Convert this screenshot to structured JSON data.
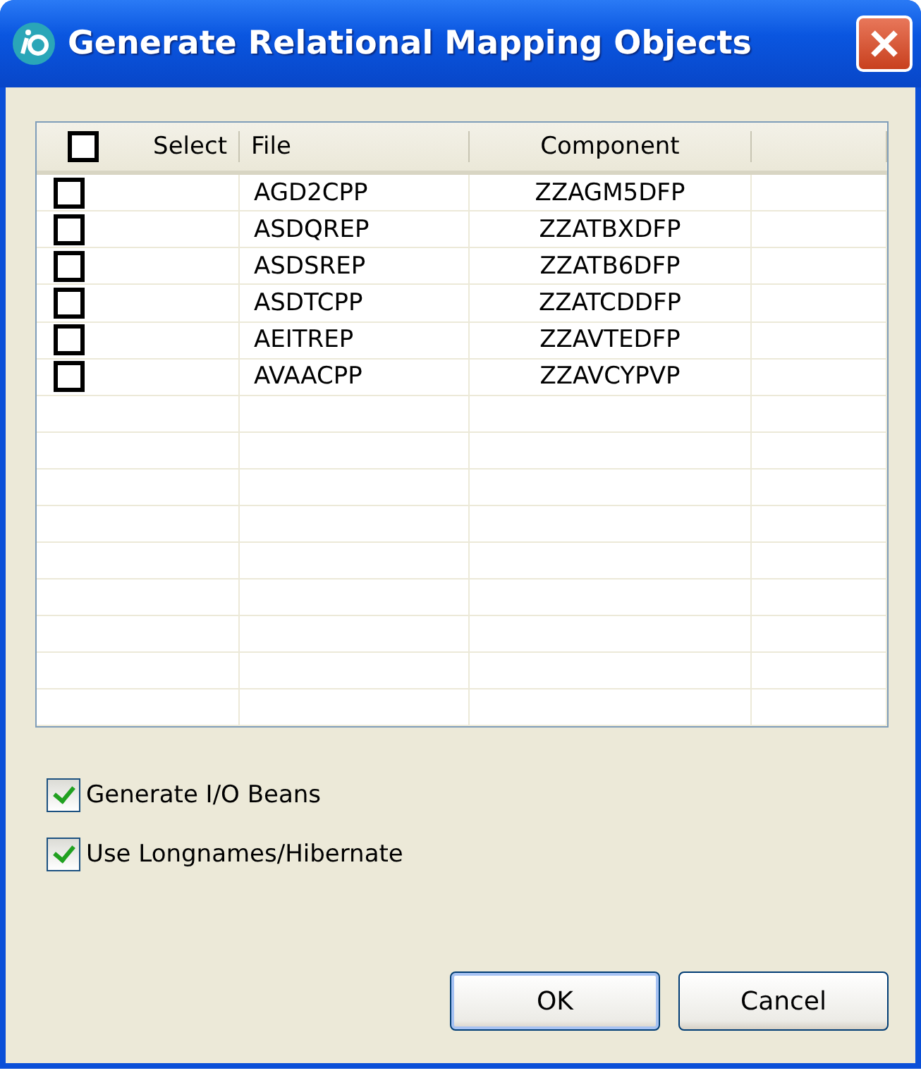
{
  "window": {
    "title": "Generate Relational Mapping Objects"
  },
  "table": {
    "select_all": {
      "checked": false
    },
    "columns": [
      "Select",
      "File",
      "Component"
    ],
    "rows": [
      {
        "checked": false,
        "file": "AGD2CPP",
        "component": "ZZAGM5DFP"
      },
      {
        "checked": false,
        "file": "ASDQREP",
        "component": "ZZATBXDFP"
      },
      {
        "checked": false,
        "file": "ASDSREP",
        "component": "ZZATB6DFP"
      },
      {
        "checked": false,
        "file": "ASDTCPP",
        "component": "ZZATCDDFP"
      },
      {
        "checked": false,
        "file": "AEITREP",
        "component": "ZZAVTEDFP"
      },
      {
        "checked": false,
        "file": "AVAACPP",
        "component": "ZZAVCYPVP"
      }
    ]
  },
  "options": [
    {
      "label": "Generate I/O Beans",
      "checked": true
    },
    {
      "label": "Use Longnames/Hibernate",
      "checked": true
    }
  ],
  "buttons": [
    {
      "label": "OK",
      "default": true
    },
    {
      "label": "Cancel",
      "default": false
    }
  ]
}
